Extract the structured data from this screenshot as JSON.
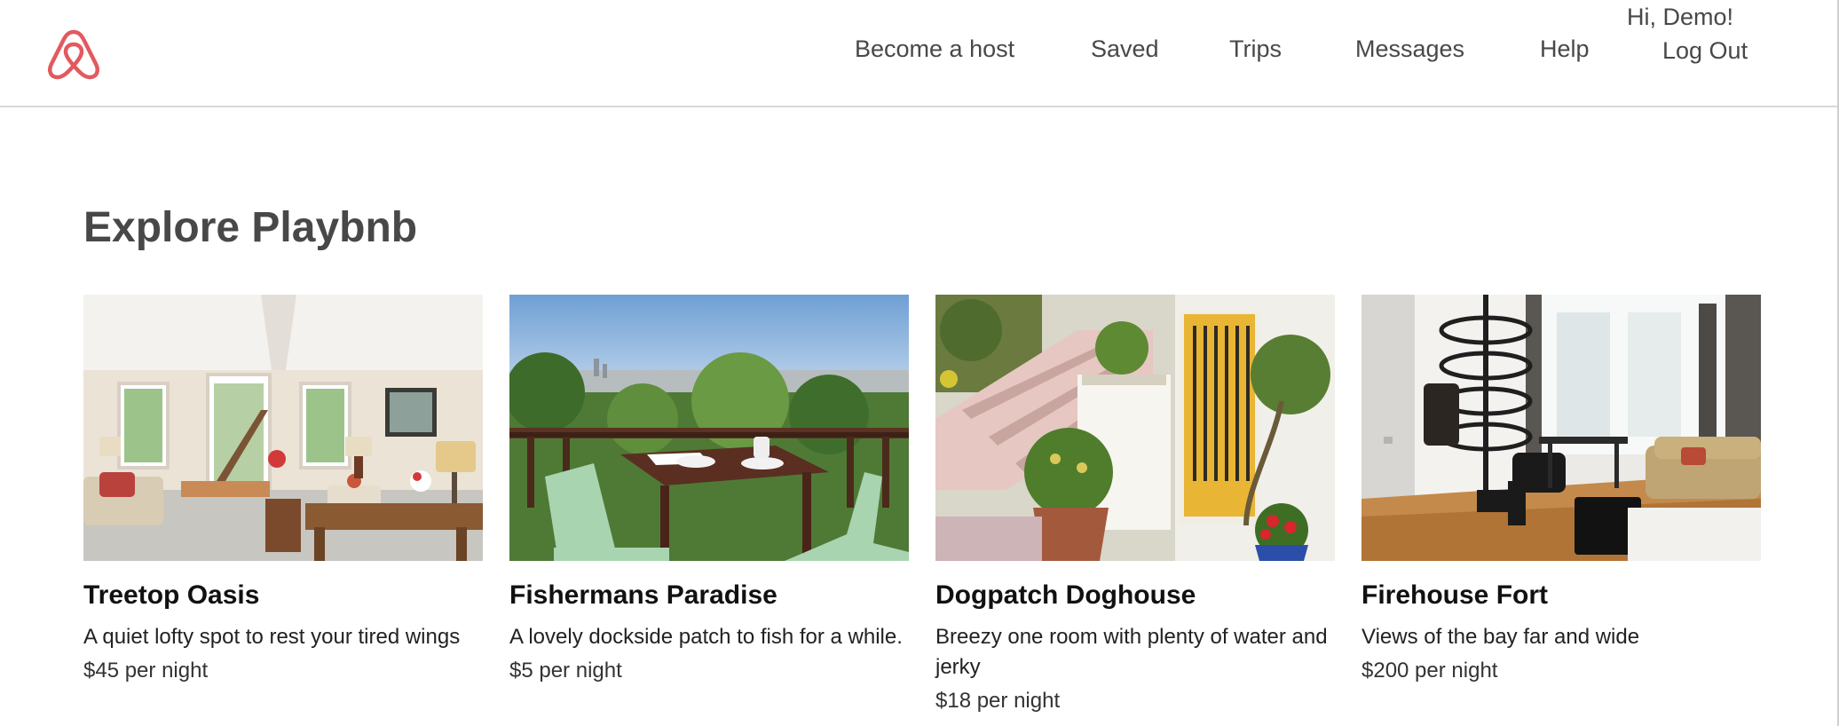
{
  "brand": {
    "logo_icon": "airbnb-logo-icon",
    "accent": "#e15a5f"
  },
  "nav": {
    "become_host": "Become a host",
    "saved": "Saved",
    "trips": "Trips",
    "messages": "Messages",
    "help": "Help",
    "greeting": "Hi, Demo!",
    "logout": "Log Out"
  },
  "main": {
    "title": "Explore Playbnb",
    "listings": [
      {
        "title": "Treetop Oasis",
        "description": "A quiet lofty spot to rest your tired wings",
        "price": "$45 per night",
        "image": "living-room-photo"
      },
      {
        "title": "Fishermans Paradise",
        "description": "A lovely dockside patch to fish for a while.",
        "price": "$5 per night",
        "image": "balcony-view-photo"
      },
      {
        "title": "Dogpatch Doghouse",
        "description": "Breezy one room with plenty of water and jerky",
        "price": "$18 per night",
        "image": "yellow-door-stairs-photo"
      },
      {
        "title": "Firehouse Fort",
        "description": "Views of the bay far and wide",
        "price": "$200 per night",
        "image": "loft-spiral-stair-photo"
      }
    ]
  }
}
